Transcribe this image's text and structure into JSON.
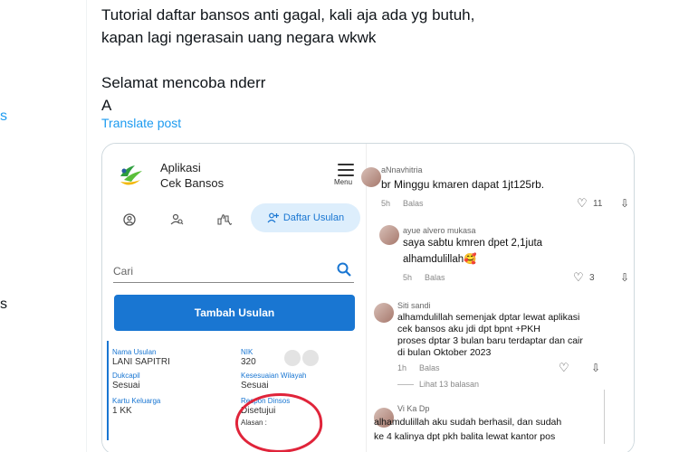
{
  "left_rail": {
    "frag_top": "s",
    "frag_bottom": "s"
  },
  "post": {
    "lines": [
      "Tutorial daftar bansos anti gagal, kali aja ada yg butuh,",
      "kapan lagi ngerasain uang negara wkwk",
      "",
      "Selamat mencoba nderr",
      "A"
    ],
    "translate": "Translate post"
  },
  "app": {
    "title_line1": "Aplikasi",
    "title_line2": "Cek Bansos",
    "menu_label": "Menu",
    "tab_daftar": "Daftar Usulan",
    "search_placeholder": "Cari",
    "add_button": "Tambah Usulan",
    "card": {
      "nama_label": "Nama Usulan",
      "nama_value": "LANI SAPITRI",
      "nik_label": "NIK",
      "nik_value": "320",
      "dukcapil_label": "Dukcapil",
      "dukcapil_value": "Sesuai",
      "wilayah_label": "Kesesuaian Wilayah",
      "wilayah_value": "Sesuai",
      "kk_label": "Kartu Keluarga",
      "kk_value": "1 KK",
      "respon_label": "Respon Dinsos",
      "respon_value": "Disetujui",
      "alasan_label": "Alasan :"
    }
  },
  "comments": [
    {
      "user": "aNnavhitria",
      "text": "br Minggu kmaren dapat 1jt125rb.",
      "time": "5h",
      "reply": "Balas",
      "likes": "11"
    },
    {
      "user": "ayue alvero mukasa",
      "text1": "saya sabtu kmren dpet 2,1juta",
      "text2": "alhamdulillah🥰",
      "time": "5h",
      "reply": "Balas",
      "likes": "3"
    },
    {
      "user": "Siti sandi",
      "text1": "alhamdulillah semenjak dptar lewat aplikasi",
      "text2": "cek bansos aku jdi dpt bpnt +PKH",
      "text3": "proses dptar 3 bulan baru terdaptar dan cair",
      "text4": "di bulan Oktober 2023",
      "time": "1h",
      "reply": "Balas",
      "more": "Lihat 13 balasan"
    },
    {
      "user": "Vi Ka Dp",
      "text1": "alhamdulillah aku sudah berhasil, dan sudah",
      "text2": "ke 4 kalinya dpt pkh balita lewat kantor pos"
    }
  ],
  "colors": {
    "accent": "#1d9bf0",
    "app_blue": "#1976d2",
    "highlight_red": "#e0243a"
  }
}
